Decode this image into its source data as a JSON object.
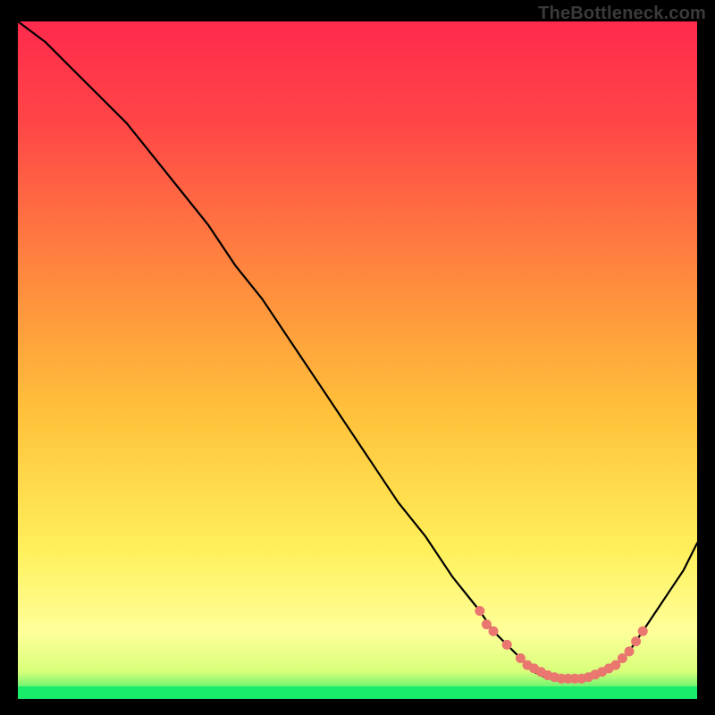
{
  "attribution": "TheBottleneck.com",
  "colors": {
    "background": "#000000",
    "gradient_top": "#ff2a4d",
    "gradient_mid": "#ffcc33",
    "gradient_low": "#ffff8a",
    "gradient_bottom": "#19eb6a",
    "curve": "#000000",
    "markers": "#e9766f"
  },
  "chart_data": {
    "type": "line",
    "title": "",
    "xlabel": "",
    "ylabel": "",
    "xlim": [
      0,
      100
    ],
    "ylim": [
      0,
      100
    ],
    "series": [
      {
        "name": "bottleneck-curve",
        "x": [
          0,
          4,
          8,
          12,
          16,
          20,
          24,
          28,
          32,
          36,
          40,
          44,
          48,
          52,
          56,
          60,
          64,
          68,
          70,
          72,
          74,
          76,
          78,
          80,
          82,
          84,
          86,
          88,
          90,
          92,
          94,
          96,
          98,
          100
        ],
        "y": [
          100,
          97,
          93,
          89,
          85,
          80,
          75,
          70,
          64,
          59,
          53,
          47,
          41,
          35,
          29,
          24,
          18,
          13,
          10,
          8,
          6,
          4,
          3,
          3,
          3,
          3,
          4,
          5,
          7,
          10,
          13,
          16,
          19,
          23
        ]
      }
    ],
    "markers": {
      "name": "highlight-band",
      "points": [
        {
          "x": 68,
          "y": 13
        },
        {
          "x": 69,
          "y": 11
        },
        {
          "x": 70,
          "y": 10
        },
        {
          "x": 72,
          "y": 8
        },
        {
          "x": 74,
          "y": 6
        },
        {
          "x": 75,
          "y": 5
        },
        {
          "x": 76,
          "y": 4.5
        },
        {
          "x": 77,
          "y": 4
        },
        {
          "x": 78,
          "y": 3.5
        },
        {
          "x": 79,
          "y": 3.2
        },
        {
          "x": 80,
          "y": 3
        },
        {
          "x": 81,
          "y": 3
        },
        {
          "x": 82,
          "y": 3
        },
        {
          "x": 83,
          "y": 3
        },
        {
          "x": 84,
          "y": 3.2
        },
        {
          "x": 85,
          "y": 3.6
        },
        {
          "x": 86,
          "y": 4
        },
        {
          "x": 87,
          "y": 4.5
        },
        {
          "x": 88,
          "y": 5
        },
        {
          "x": 89,
          "y": 6
        },
        {
          "x": 90,
          "y": 7
        },
        {
          "x": 91,
          "y": 8.5
        },
        {
          "x": 92,
          "y": 10
        }
      ]
    }
  }
}
